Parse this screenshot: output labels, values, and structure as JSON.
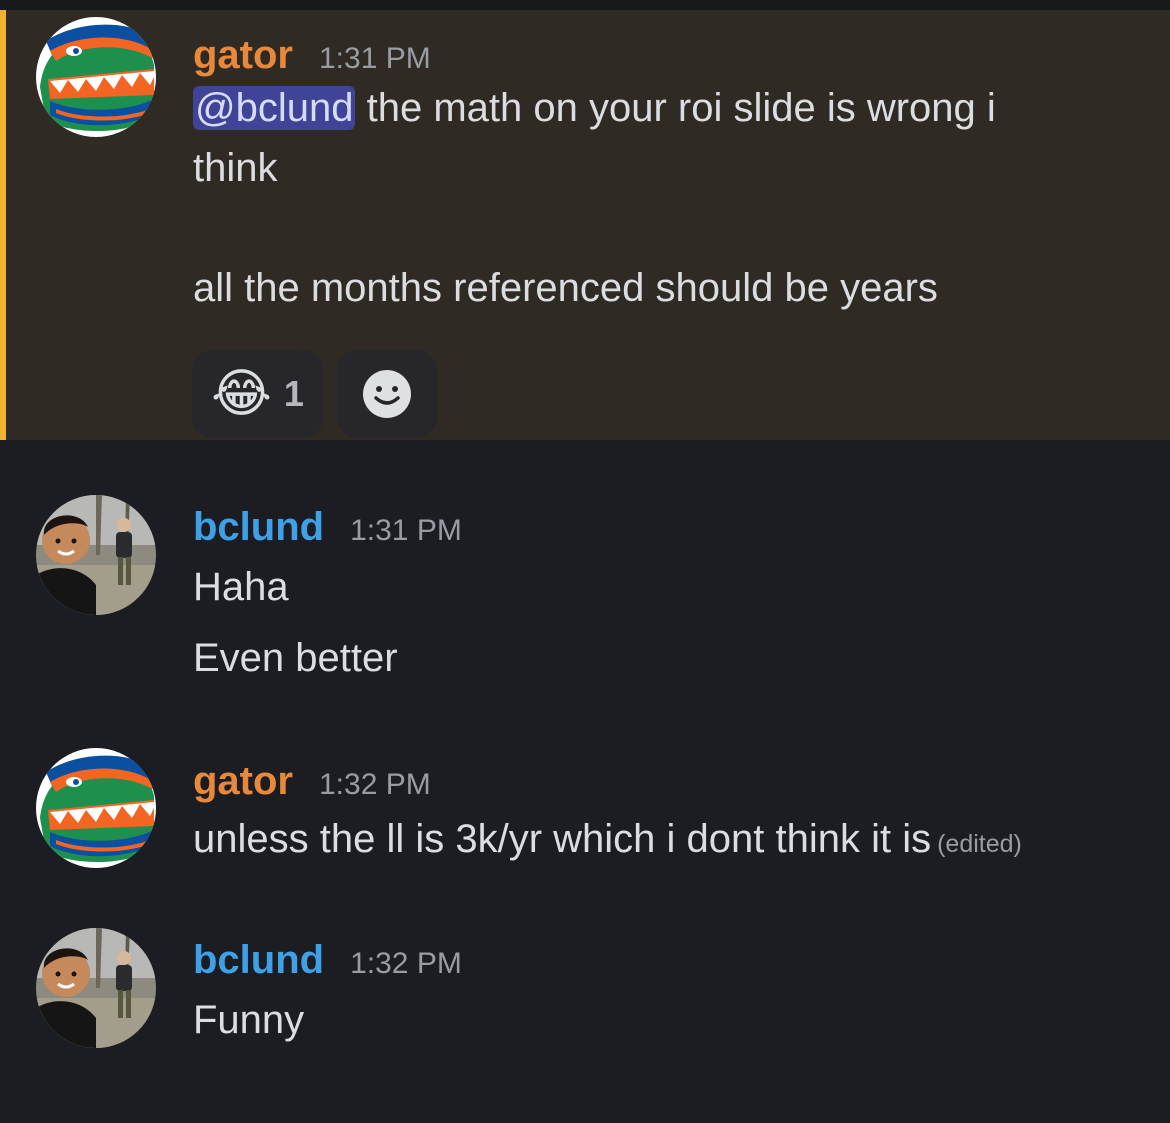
{
  "messages": [
    {
      "author": "gator",
      "time": "1:31 PM",
      "mention": "@bclund",
      "lines": [
        " the math on your roi slide is wrong i",
        "think",
        "all the months referenced should be years"
      ],
      "reactions": [
        {
          "emoji": "😂",
          "icon": "tears-of-joy-emoji-icon",
          "count": "1"
        },
        {
          "icon": "add-reaction-smiley-icon"
        }
      ]
    },
    {
      "author": "bclund",
      "time": "1:31 PM",
      "lines": [
        "Haha",
        "Even better"
      ]
    },
    {
      "author": "gator",
      "time": "1:32 PM",
      "lines": [
        "unless the ll is 3k/yr which i dont think it is"
      ],
      "edited": "(edited)"
    },
    {
      "author": "bclund",
      "time": "1:32 PM",
      "lines": [
        "Funny"
      ]
    }
  ],
  "colors": {
    "gator_name": "#e7883a",
    "bclund_name": "#3ea0e6",
    "mention_highlight_bg": "#2f2b24",
    "mention_bar": "#f0b232",
    "mention_pill": "#3f4497",
    "background": "#1c1d22"
  }
}
